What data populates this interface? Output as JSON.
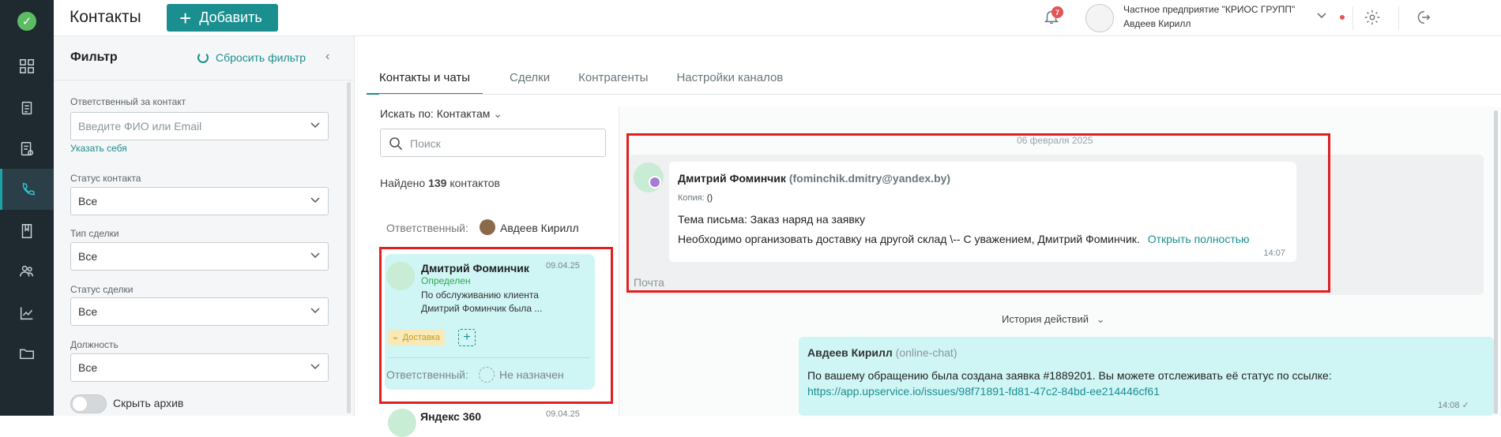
{
  "header": {
    "title": "Контакты",
    "add_label": "Добавить",
    "notifications_count": "7",
    "org_name": "Частное предприятие \"КРИОС ГРУПП\"",
    "user_name": "Авдеев Кирилл"
  },
  "rail": {
    "items": [
      "dashboard-icon",
      "tasks-icon",
      "requests-icon",
      "contacts-icon",
      "knowledge-icon",
      "team-icon",
      "reports-icon",
      "folders-icon"
    ],
    "active": "contacts-icon"
  },
  "filter": {
    "title": "Фильтр",
    "reset_label": "Сбросить фильтр",
    "responsible_label": "Ответственный за контакт",
    "responsible_placeholder": "Введите ФИО или Email",
    "assign_self": "Указать себя",
    "contact_status_label": "Статус контакта",
    "contact_status_value": "Все",
    "deal_type_label": "Тип сделки",
    "deal_type_value": "Все",
    "deal_status_label": "Статус сделки",
    "deal_status_value": "Все",
    "position_label": "Должность",
    "position_value": "Все",
    "hide_archive_label": "Скрыть архив"
  },
  "tabs": [
    {
      "label": "Контакты и чаты",
      "active": true
    },
    {
      "label": "Сделки"
    },
    {
      "label": "Контрагенты"
    },
    {
      "label": "Настройки каналов"
    }
  ],
  "contacts": {
    "search_by": "Искать по: Контактам",
    "search_placeholder": "Поиск",
    "found_prefix": "Найдено",
    "found_count": "139",
    "found_suffix": "контактов",
    "responsible_label": "Ответственный:",
    "responsible_name": "Авдеев Кирилл",
    "selected": {
      "name": "Дмитрий Фоминчик",
      "date": "09.04.25",
      "status": "Определен",
      "preview_line1": "По обслуживанию клиента",
      "preview_line2": "Дмитрий Фоминчик была ...",
      "tag": "Доставка",
      "responsible_label": "Ответственный:",
      "responsible_value": "Не назначен"
    },
    "next": {
      "name": "Яндекс 360",
      "date": "09.04.25"
    }
  },
  "chat": {
    "date": "06 февраля 2025",
    "mail": {
      "sender": "Дмитрий Фоминчик",
      "email": "(fominchik.dmitry@yandex.by)",
      "copy_label": "Копия:",
      "copy_value": "()",
      "subject": "Тема письма: Заказ наряд на заявку",
      "body": "Необходимо организовать доставку на другой склад \\-- С уважением, Дмитрий Фоминчик.",
      "open_full": "Открыть полностью",
      "time": "14:07",
      "channel": "Почта"
    },
    "history_label": "История действий",
    "outgoing": {
      "sender": "Авдеев Кирилл",
      "source": "(online-chat)",
      "text": "По вашему обращению была создана заявка #1889201. Вы можете отслеживать её статус по ссылке:",
      "link": "https://app.upservice.io/issues/98f71891-fd81-47c2-84bd-ee214446cf61",
      "time": "14:08"
    }
  },
  "colors": {
    "accent": "#1b8f8f",
    "rail": "#1f2a30",
    "highlight": "#e02020",
    "selected_card": "#cff5f5"
  }
}
